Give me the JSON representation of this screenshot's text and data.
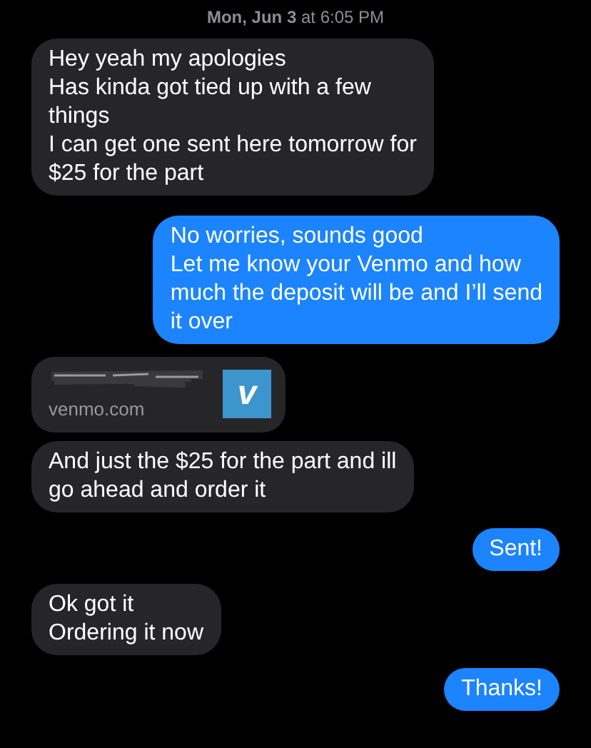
{
  "timestamp": {
    "day": "Mon, Jun 3",
    "at": "at",
    "time": "6:05 PM"
  },
  "messages": [
    {
      "kind": "text",
      "sent": false,
      "text": "Hey yeah my apologies\nHas kinda got tied up with a few\nthings\nI can get one sent here tomorrow for\n$25 for the part"
    },
    {
      "kind": "text",
      "sent": true,
      "text": "No worries, sounds good\nLet me know your Venmo and how\nmuch the deposit will be and I’ll send\nit over"
    },
    {
      "kind": "link",
      "sent": false,
      "domain": "venmo.com",
      "logo": "v"
    },
    {
      "kind": "text",
      "sent": false,
      "text": "And just the $25 for the part and ill\ngo ahead and order it"
    },
    {
      "kind": "text",
      "sent": true,
      "text": "Sent!"
    },
    {
      "kind": "text",
      "sent": false,
      "text": "Ok got it\nOrdering it now"
    },
    {
      "kind": "text",
      "sent": true,
      "text": "Thanks!"
    }
  ]
}
